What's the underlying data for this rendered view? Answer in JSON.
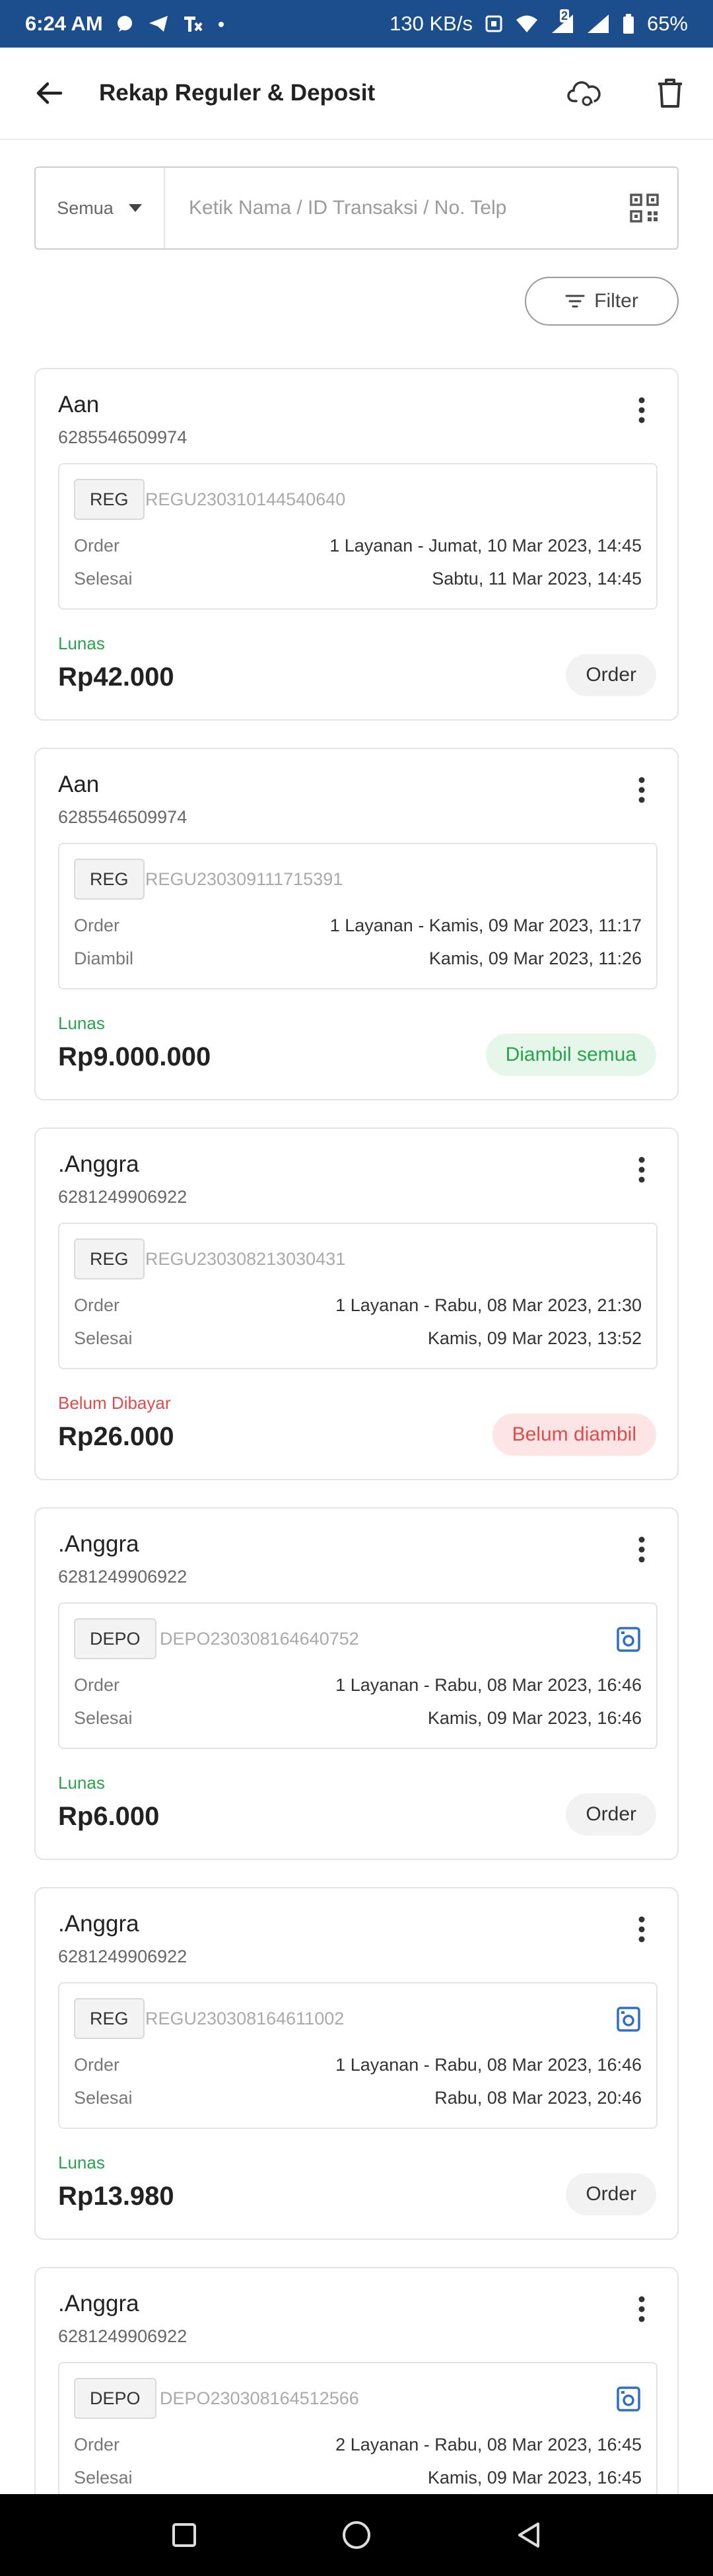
{
  "status_bar": {
    "time": "6:24 AM",
    "speed": "130 KB/s",
    "battery": "65%",
    "signal_badge": "2",
    "icons": [
      "whatsapp-icon",
      "telegram-icon",
      "app-icon",
      "dot-icon",
      "nfc-icon",
      "wifi-icon",
      "signal-icon",
      "battery-icon"
    ]
  },
  "app_bar": {
    "title": "Rekap Reguler & Deposit",
    "icons": [
      "back-arrow-icon",
      "cloud-sync-icon",
      "trash-icon"
    ]
  },
  "search": {
    "selected_filter": "Semua",
    "placeholder": "Ketik Nama / ID Transaksi / No. Telp"
  },
  "filter_button": {
    "label": "Filter"
  },
  "colors": {
    "status_bar": "#1c4e8e",
    "paid_green": "#27a44c",
    "unpaid_red": "#e24b4b",
    "scan_blue": "#2f6fc9"
  },
  "cards": [
    {
      "name": "Aan",
      "phone": "6285546509974",
      "type": "REG",
      "id": "REGU230310144540640",
      "row1_label": "Order",
      "row1_value": "1 Layanan - Jumat, 10 Mar 2023, 14:45",
      "row2_label": "Selesai",
      "row2_value": "Sabtu, 11 Mar 2023, 14:45",
      "payment": "Lunas",
      "amount": "Rp42.000",
      "action": "Order",
      "show_scan_icon": false
    },
    {
      "name": "Aan",
      "phone": "6285546509974",
      "type": "REG",
      "id": "REGU230309111715391",
      "row1_label": "Order",
      "row1_value": "1 Layanan - Kamis, 09 Mar 2023, 11:17",
      "row2_label": "Diambil",
      "row2_value": "Kamis, 09 Mar 2023, 11:26",
      "payment": "Lunas",
      "amount": "Rp9.000.000",
      "action": "Diambil semua",
      "show_scan_icon": false
    },
    {
      "name": ".Anggra",
      "phone": "6281249906922",
      "type": "REG",
      "id": "REGU230308213030431",
      "row1_label": "Order",
      "row1_value": "1 Layanan - Rabu, 08 Mar 2023, 21:30",
      "row2_label": "Selesai",
      "row2_value": "Kamis, 09 Mar 2023, 13:52",
      "payment": "Belum Dibayar",
      "amount": "Rp26.000",
      "action": "Belum diambil",
      "show_scan_icon": false
    },
    {
      "name": ".Anggra",
      "phone": "6281249906922",
      "type": "DEPO",
      "id": "DEPO230308164640752",
      "row1_label": "Order",
      "row1_value": "1 Layanan - Rabu, 08 Mar 2023, 16:46",
      "row2_label": "Selesai",
      "row2_value": "Kamis, 09 Mar 2023, 16:46",
      "payment": "Lunas",
      "amount": "Rp6.000",
      "action": "Order",
      "show_scan_icon": true
    },
    {
      "name": ".Anggra",
      "phone": "6281249906922",
      "type": "REG",
      "id": "REGU230308164611002",
      "row1_label": "Order",
      "row1_value": "1 Layanan - Rabu, 08 Mar 2023, 16:46",
      "row2_label": "Selesai",
      "row2_value": "Rabu, 08 Mar 2023, 20:46",
      "payment": "Lunas",
      "amount": "Rp13.980",
      "action": "Order",
      "show_scan_icon": true
    },
    {
      "name": ".Anggra",
      "phone": "6281249906922",
      "type": "DEPO",
      "id": "DEPO230308164512566",
      "row1_label": "Order",
      "row1_value": "2 Layanan - Rabu, 08 Mar 2023, 16:45",
      "row2_label": "Selesai",
      "row2_value": "Kamis, 09 Mar 2023, 16:45",
      "show_scan_icon": true
    }
  ],
  "nav_bar": {
    "icons": [
      "recents-square-icon",
      "home-circle-icon",
      "back-triangle-icon"
    ]
  }
}
